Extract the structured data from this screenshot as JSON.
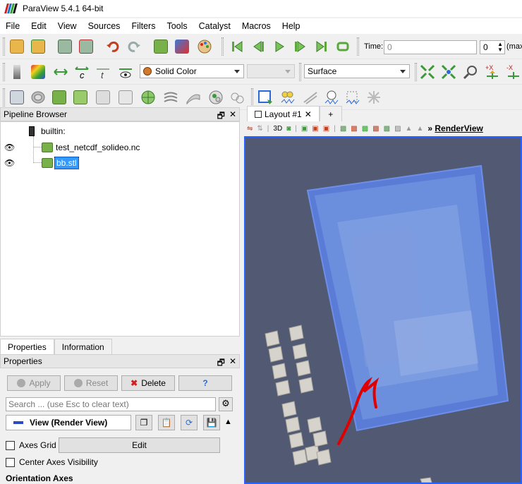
{
  "window": {
    "title": "ParaView 5.4.1 64-bit"
  },
  "menu": [
    "File",
    "Edit",
    "View",
    "Sources",
    "Filters",
    "Tools",
    "Catalyst",
    "Macros",
    "Help"
  ],
  "time": {
    "label": "Time:",
    "value": "0",
    "index": "0",
    "suffix": "(max"
  },
  "representation": {
    "color_label": "Solid Color",
    "style_label": "Surface"
  },
  "pipeline": {
    "header": "Pipeline Browser",
    "items": [
      {
        "label": "builtin:"
      },
      {
        "label": "test_netcdf_solideo.nc"
      },
      {
        "label": "bb.stl"
      }
    ]
  },
  "layout": {
    "tab_label": "Layout #1",
    "add_tab": "+",
    "view_label": "3D",
    "render_view_link": "RenderView"
  },
  "properties_tabs": [
    "Properties",
    "Information"
  ],
  "properties": {
    "header": "Properties",
    "apply": "Apply",
    "reset": "Reset",
    "delete": "Delete",
    "help": "?",
    "search_placeholder": "Search ... (use Esc to clear text)",
    "view_label": "View (Render View)",
    "axes_grid": "Axes Grid",
    "edit": "Edit",
    "center_axes": "Center Axes Visibility",
    "orientation_axes": "Orientation Axes"
  },
  "colors": {
    "accent": "#2a62ff",
    "background": "#525a73",
    "selection": "#3399ff",
    "arrow": "#e00000"
  }
}
